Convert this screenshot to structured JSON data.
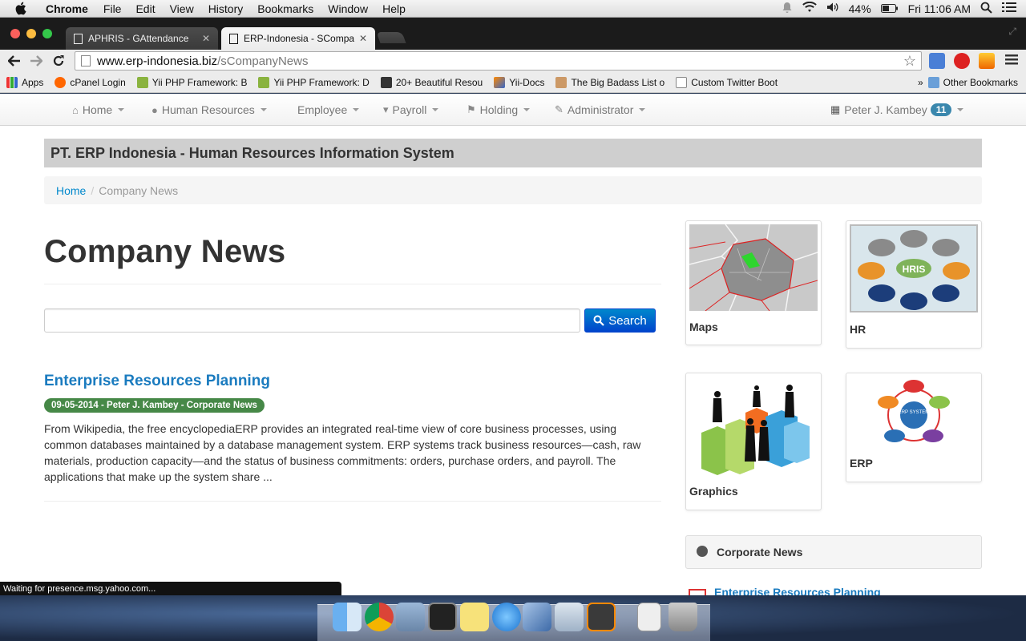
{
  "menubar": {
    "app": "Chrome",
    "items": [
      "File",
      "Edit",
      "View",
      "History",
      "Bookmarks",
      "Window",
      "Help"
    ],
    "battery": "44%",
    "clock": "Fri 11:06 AM"
  },
  "browser": {
    "tabs": [
      {
        "title": "APHRIS - GAttendance"
      },
      {
        "title": "ERP-Indonesia - SCompanyNews"
      }
    ],
    "url_host": "www.erp-indonesia.biz",
    "url_path": "/sCompanyNews",
    "bookmarks": [
      "Apps",
      "cPanel Login",
      "Yii PHP Framework: B",
      "Yii PHP Framework: D",
      "20+ Beautiful Resou",
      "Yii-Docs",
      "The Big Badass List o",
      "Custom Twitter Boot"
    ],
    "bookmarks_more": "»",
    "other_bookmarks": "Other Bookmarks",
    "status": "Waiting for presence.msg.yahoo.com..."
  },
  "nav": {
    "items": [
      {
        "label": "Home",
        "icon": "home-icon"
      },
      {
        "label": "Human Resources",
        "icon": "user-icon"
      },
      {
        "label": "Employee",
        "icon": ""
      },
      {
        "label": "Payroll",
        "icon": "cart-icon"
      },
      {
        "label": "Holding",
        "icon": "flag-icon"
      },
      {
        "label": "Administrator",
        "icon": "wrench-icon"
      }
    ],
    "user": "Peter J. Kambey",
    "user_badge": "11"
  },
  "site_title": "PT. ERP Indonesia - Human Resources Information System",
  "breadcrumb": {
    "home": "Home",
    "separator": "/",
    "current": "Company News"
  },
  "page_title": "Company News",
  "search": {
    "value": "",
    "button": "Search"
  },
  "news": [
    {
      "title": "Enterprise Resources Planning",
      "meta": "09-05-2014 - Peter J. Kambey - Corporate News",
      "body": "From Wikipedia, the free encyclopediaERP provides an integrated real-time view of core business processes, using common databases maintained by a database management system. ERP systems track business resources—cash, raw materials, production capacity—and the status of business commitments: orders, purchase orders, and payroll. The applications that make up the system share ..."
    }
  ],
  "sidebar": {
    "thumbnails": [
      {
        "caption": "Maps"
      },
      {
        "caption": "HR",
        "image_text": "HRIS"
      },
      {
        "caption": "Graphics"
      },
      {
        "caption": "ERP",
        "image_text": "ERP SYSTEM"
      }
    ],
    "panel_title": "Corporate News",
    "panel_link": "Enterprise Resources Planning"
  },
  "colors": {
    "link": "#1a7bbf",
    "primary_button": "#0088cc",
    "meta_badge": "#468847",
    "user_badge": "#3a87ad"
  }
}
